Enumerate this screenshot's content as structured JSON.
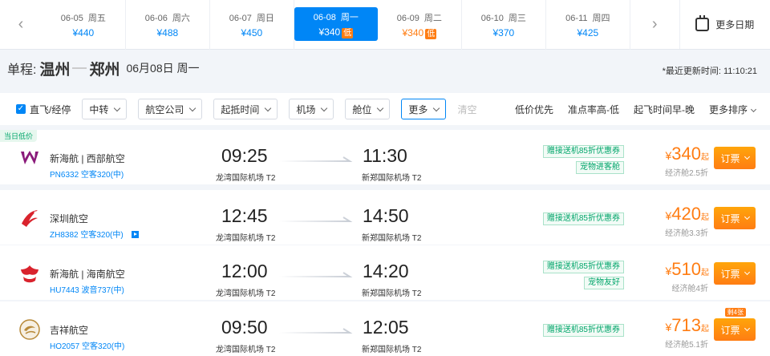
{
  "dates": [
    {
      "date": "06-05",
      "weekday": "周五",
      "price": "¥440",
      "low": false,
      "active": false
    },
    {
      "date": "06-06",
      "weekday": "周六",
      "price": "¥488",
      "low": false,
      "active": false
    },
    {
      "date": "06-07",
      "weekday": "周日",
      "price": "¥450",
      "low": false,
      "active": false
    },
    {
      "date": "06-08",
      "weekday": "周一",
      "price": "¥340",
      "low": true,
      "active": true
    },
    {
      "date": "06-09",
      "weekday": "周二",
      "price": "¥340",
      "low": true,
      "active": false
    },
    {
      "date": "06-10",
      "weekday": "周三",
      "price": "¥370",
      "low": false,
      "active": false
    },
    {
      "date": "06-11",
      "weekday": "周四",
      "price": "¥425",
      "low": false,
      "active": false
    }
  ],
  "low_tag": "低",
  "more_dates": "更多日期",
  "route": {
    "label": "单程:",
    "from": "温州",
    "to": "郑州",
    "date": "06月08日 周一",
    "updated": "*最近更新时间: 11:10:21"
  },
  "filters": {
    "direct_label": "直飞/经停",
    "dropdowns": [
      "中转",
      "航空公司",
      "起抵时间",
      "机场",
      "舱位",
      "更多"
    ],
    "clear": "清空",
    "sorts": [
      "低价优先",
      "准点率高-低",
      "起飞时间早-晚",
      "更多排序"
    ]
  },
  "flights": [
    {
      "airline": "新海航 | 西部航空",
      "flight_no": "PN6332 空客320(中)",
      "dep_time": "09:25",
      "dep_airport": "龙湾国际机场 T2",
      "arr_time": "11:30",
      "arr_airport": "新郑国际机场 T2",
      "coupons": [
        "赠接送机85折优惠券",
        "宠物进客舱"
      ],
      "price": "340",
      "currency": "¥",
      "qi": "起",
      "cabin": "经济舱2.5折",
      "book": "订票",
      "badge": "当日低价",
      "new_tag": "",
      "video": false,
      "logo_color": "#8a1a7a"
    },
    {
      "airline": "深圳航空",
      "flight_no": "ZH8382 空客320(中)",
      "dep_time": "12:45",
      "dep_airport": "龙湾国际机场 T2",
      "arr_time": "14:50",
      "arr_airport": "新郑国际机场 T2",
      "coupons": [
        "赠接送机85折优惠券"
      ],
      "price": "420",
      "currency": "¥",
      "qi": "起",
      "cabin": "经济舱3.3折",
      "book": "订票",
      "badge": "",
      "new_tag": "",
      "video": true,
      "logo_color": "#d9232d"
    },
    {
      "airline": "新海航 | 海南航空",
      "flight_no": "HU7443 波音737(中)",
      "dep_time": "12:00",
      "dep_airport": "龙湾国际机场 T2",
      "arr_time": "14:20",
      "arr_airport": "新郑国际机场 T2",
      "coupons": [
        "赠接送机85折优惠券",
        "宠物友好"
      ],
      "price": "510",
      "currency": "¥",
      "qi": "起",
      "cabin": "经济舱4折",
      "book": "订票",
      "badge": "",
      "new_tag": "",
      "video": false,
      "logo_color": "#d9232d"
    },
    {
      "airline": "吉祥航空",
      "flight_no": "HO2057 空客320(中)",
      "dep_time": "09:50",
      "dep_airport": "龙湾国际机场 T2",
      "arr_time": "12:05",
      "arr_airport": "新郑国际机场 T2",
      "coupons": [
        "赠接送机85折优惠券"
      ],
      "price": "713",
      "currency": "¥",
      "qi": "起",
      "cabin": "经济舱5.1折",
      "book": "订票",
      "badge": "",
      "new_tag": "剩4张",
      "video": false,
      "logo_color": "#b88a3a"
    }
  ]
}
